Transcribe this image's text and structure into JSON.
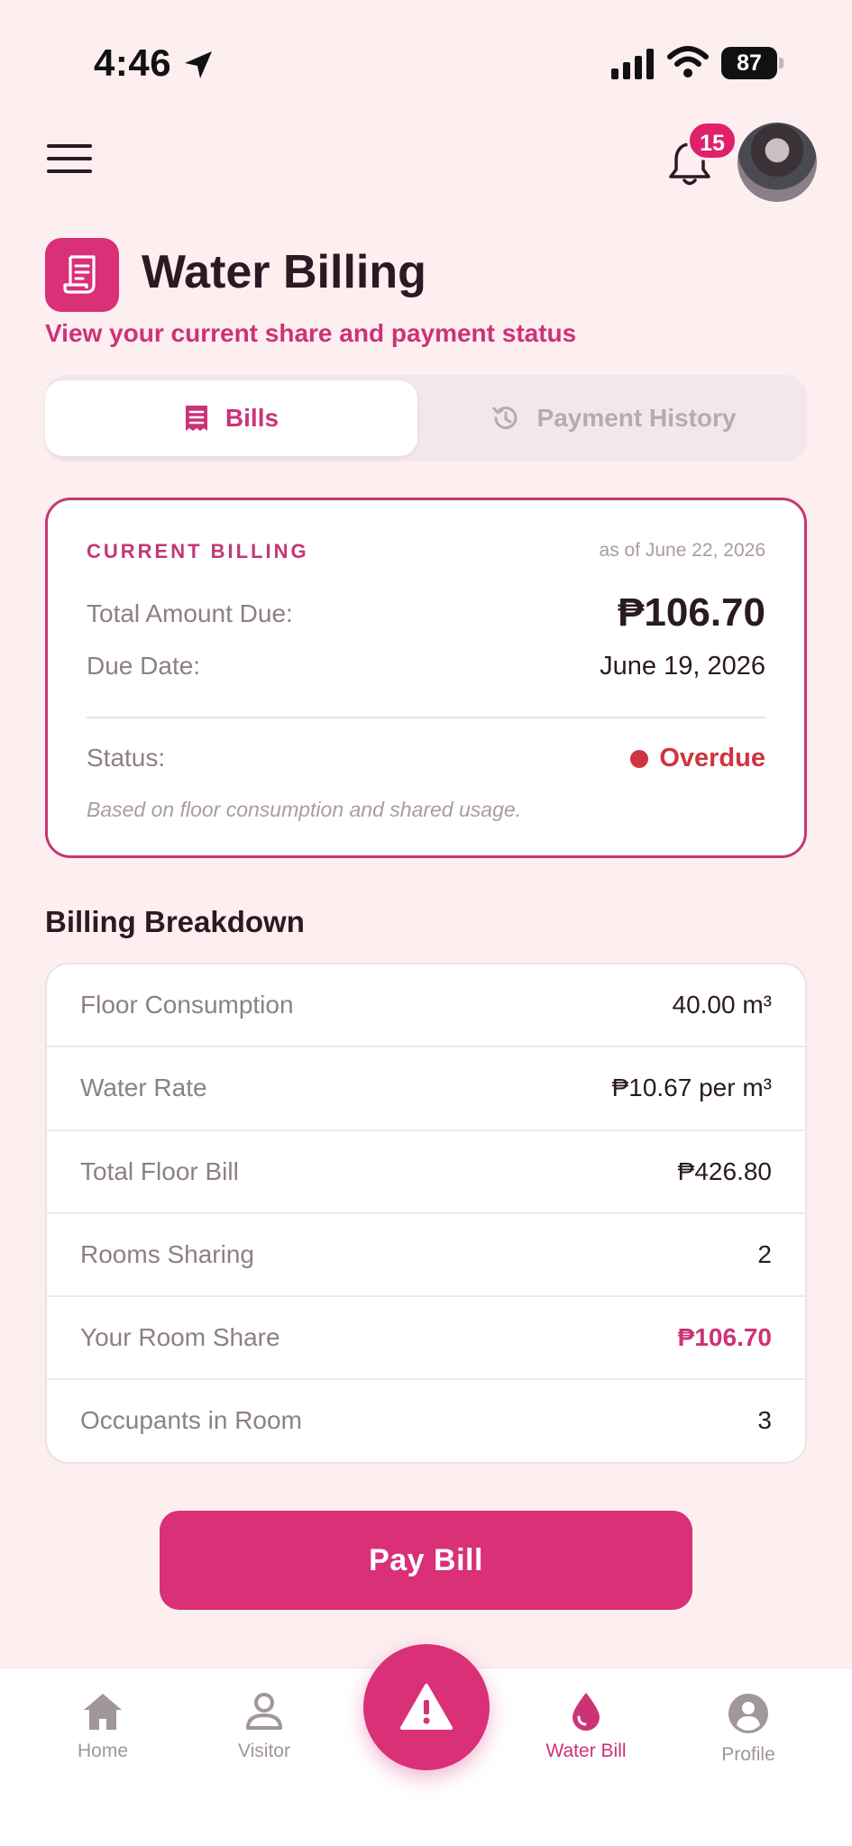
{
  "status_bar": {
    "time": "4:46",
    "battery": "87"
  },
  "header": {
    "notification_count": "15"
  },
  "page": {
    "title": "Water Billing",
    "subtitle": "View your current share and payment status"
  },
  "tabs": [
    {
      "label": "Bills",
      "active": true
    },
    {
      "label": "Payment History",
      "active": false
    }
  ],
  "current_billing": {
    "label": "CURRENT BILLING",
    "as_of": "as of June 22, 2026",
    "total_label": "Total Amount Due:",
    "total_value": "₱106.70",
    "due_label": "Due Date:",
    "due_value": "June 19, 2026",
    "status_label": "Status:",
    "status_value": "Overdue",
    "note": "Based on floor consumption and shared usage."
  },
  "breakdown": {
    "title": "Billing Breakdown",
    "rows": [
      {
        "label": "Floor Consumption",
        "value": "40.00 m³"
      },
      {
        "label": "Water Rate",
        "value": "₱10.67 per m³"
      },
      {
        "label": "Total Floor Bill",
        "value": "₱426.80"
      },
      {
        "label": "Rooms Sharing",
        "value": "2"
      },
      {
        "label": "Your Room Share",
        "value": "₱106.70"
      },
      {
        "label": "Occupants in Room",
        "value": "3"
      }
    ]
  },
  "pay_button": "Pay Bill",
  "nav": [
    {
      "label": "Home",
      "icon": "home-icon"
    },
    {
      "label": "Visitor",
      "icon": "user-icon"
    },
    {
      "label": "Water Bill",
      "icon": "water-drop-icon",
      "active": true
    },
    {
      "label": "Profile",
      "icon": "profile-icon"
    }
  ],
  "colors": {
    "accent": "#d93078",
    "overdue": "#d0343f",
    "background": "#fdeef0"
  }
}
